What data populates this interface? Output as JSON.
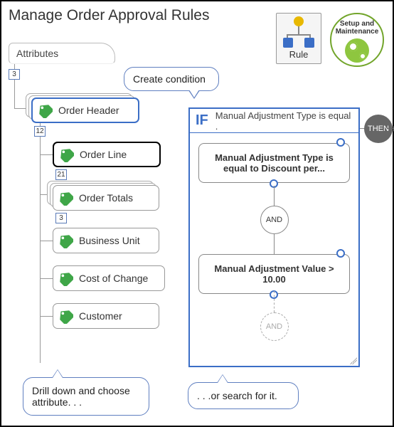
{
  "title": "Manage Order Approval Rules",
  "top_icons": {
    "rule_label": "Rule",
    "setup_line1": "Setup and",
    "setup_line2": "Maintenance"
  },
  "attributes_panel_label": "Attributes",
  "tree": {
    "root_count": "3",
    "order_header": {
      "label": "Order Header",
      "count": "12"
    },
    "children": [
      {
        "label": "Order Line",
        "count": "21"
      },
      {
        "label": "Order Totals",
        "count": "3"
      },
      {
        "label": "Business Unit"
      },
      {
        "label": "Cost of Change"
      },
      {
        "label": "Customer"
      }
    ]
  },
  "callouts": {
    "create_condition": "Create condition",
    "drill_down": "Drill down and choose attribute. . .",
    "search": ". . .or search for it."
  },
  "condition": {
    "if_label": "IF",
    "summary": "Manual Adjustment Type is equal .",
    "box1": "Manual Adjustment Type is equal to Discount per...",
    "and_label": "AND",
    "box2": "Manual Adjustment Value > 10.00",
    "and2_label": "AND"
  },
  "then_label": "THEN"
}
